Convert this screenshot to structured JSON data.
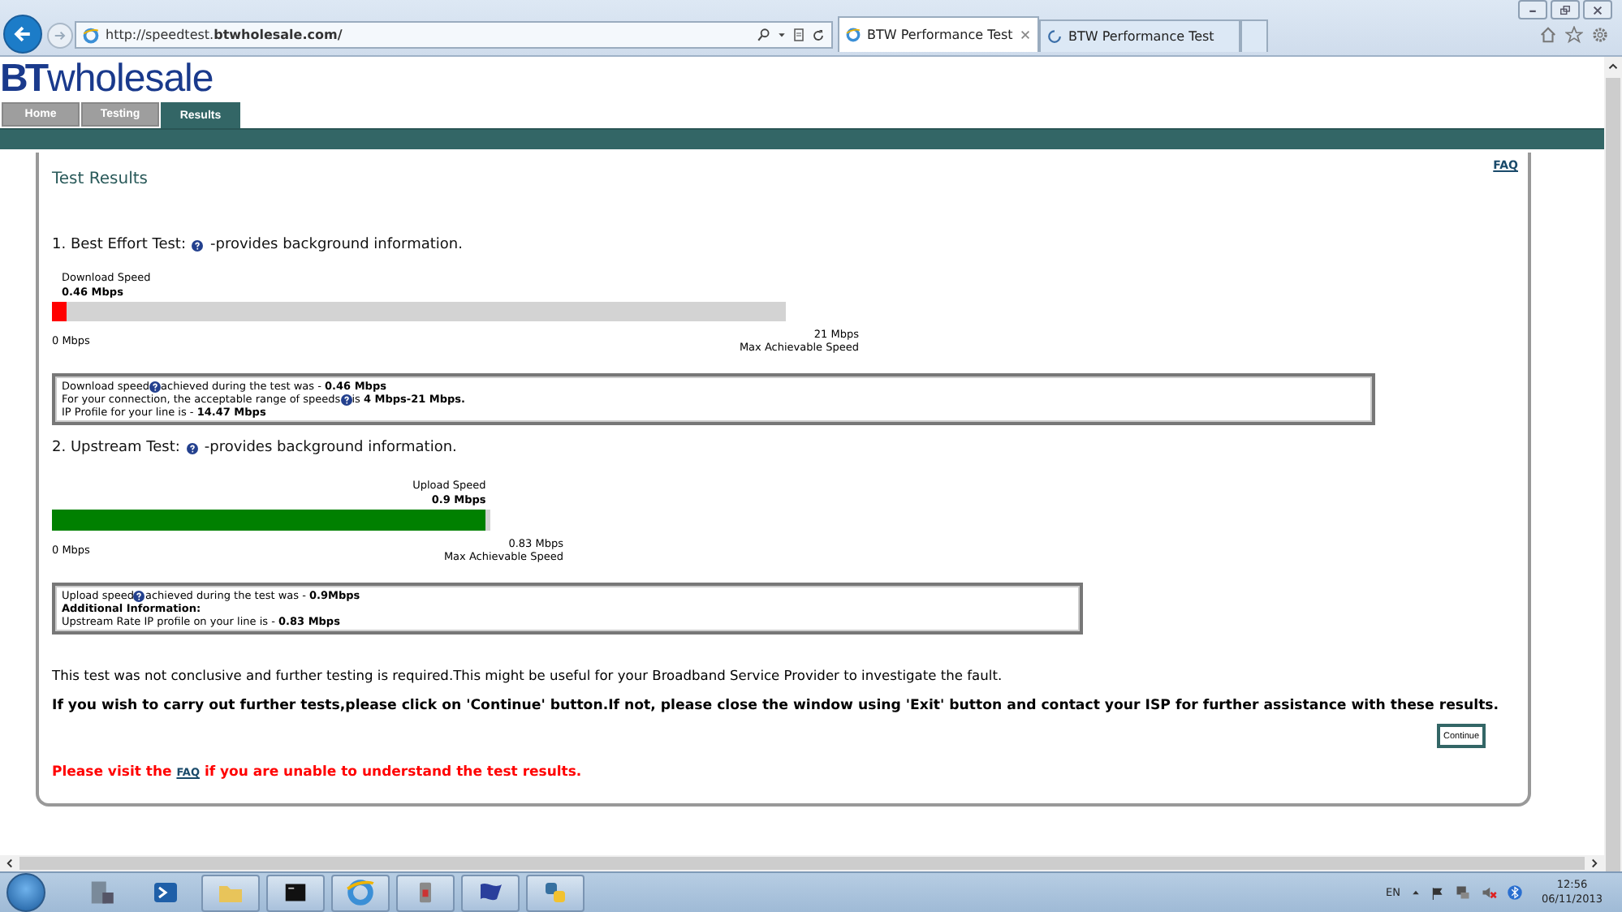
{
  "browser": {
    "url": "http://speedtest.**btwholesale.com/**",
    "tabs": [
      {
        "title": "BTW Performance Test",
        "selected": true,
        "loading": false
      },
      {
        "title": "BTW Performance Test",
        "selected": false,
        "loading": true
      }
    ]
  },
  "site": {
    "logo_mark": "BT",
    "logo_text": "wholesale",
    "nav": [
      {
        "label": "Home",
        "selected": false
      },
      {
        "label": "Testing",
        "selected": false
      },
      {
        "label": "Results",
        "selected": true
      }
    ]
  },
  "results": {
    "title": "Test Results",
    "faq_link": "FAQ",
    "tests": [
      {
        "kind": "download",
        "heading": "1. Best Effort Test:",
        "heading_rest": "-provides background information.",
        "bar_label": "Download  Speed",
        "bar_value": "0.46 Mbps",
        "level": 0.02,
        "color": "#ff0000",
        "min": "0 Mbps",
        "max": "21 Mbps",
        "max_caption": "Max Achievable Speed",
        "info": [
          {
            "text": "Download speed",
            "help": true,
            "rest": "achieved during the test was - **0.46 Mbps**",
            "bold": false
          },
          {
            "text": "For your connection, the acceptable range of speeds",
            "help": true,
            "rest": " is **4 Mbps-21 Mbps.**",
            "bold": false
          },
          {
            "text": "IP Profile for your line is - **14.47 Mbps**",
            "help": false,
            "bold": false
          }
        ]
      },
      {
        "kind": "upload",
        "heading": "2. Upstream Test:",
        "heading_rest": "-provides background information.",
        "bar_label": "Upload Speed",
        "bar_value": "0.9 Mbps",
        "level": 0.99,
        "color": "#008000",
        "min": "0 Mbps",
        "max": "0.83 Mbps",
        "max_caption": "Max Achievable Speed",
        "info": [
          {
            "text": "Upload speed",
            "help": true,
            "rest": " achieved during the test was - **0.9Mbps**",
            "bold": false
          },
          {
            "text": "Additional Information:",
            "help": false,
            "bold": true
          },
          {
            "text": "Upstream Rate IP profile on your line is - **0.83 Mbps**",
            "help": false,
            "bold": false
          }
        ]
      }
    ],
    "note": "This test was not conclusive and further testing is required.This might be useful for your Broadband Service Provider to investigate the fault.",
    "instruction": "If you wish to carry out further tests,please click on 'Continue' button.If not, please close the window using 'Exit' button and contact your ISP for further assistance with these results.",
    "continue_button": "Continue",
    "warning_before": "Please visit the ",
    "warning_link": "FAQ",
    "warning_after": " if you are unable to understand the test results."
  },
  "taskbar": {
    "language": "EN",
    "time": "12:56",
    "date": "06/11/2013"
  }
}
